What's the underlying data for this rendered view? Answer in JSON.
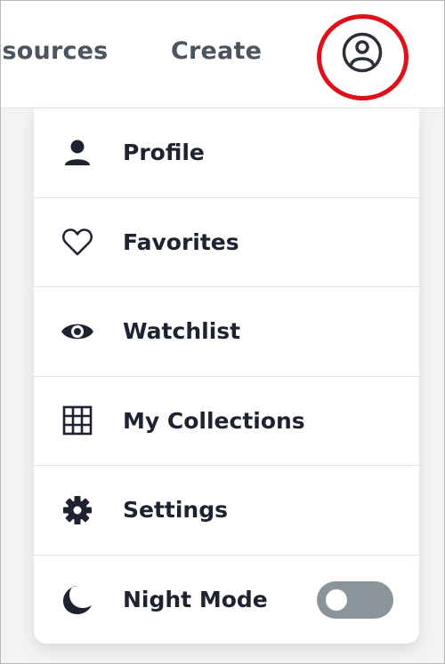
{
  "topbar": {
    "nav": {
      "resources_label": "esources",
      "create_label": "Create"
    },
    "account_icon": "user-circle-icon",
    "highlight_color": "#e0101a"
  },
  "menu": {
    "items": [
      {
        "label": "Profile",
        "icon": "person-icon"
      },
      {
        "label": "Favorites",
        "icon": "heart-icon"
      },
      {
        "label": "Watchlist",
        "icon": "eye-icon"
      },
      {
        "label": "My Collections",
        "icon": "grid-icon"
      },
      {
        "label": "Settings",
        "icon": "gear-icon"
      },
      {
        "label": "Night Mode",
        "icon": "moon-icon"
      }
    ],
    "night_mode": {
      "enabled": false
    }
  },
  "colors": {
    "text": "#1d2330",
    "nav_text": "#4a5560",
    "toggle_off": "#8a949b"
  }
}
